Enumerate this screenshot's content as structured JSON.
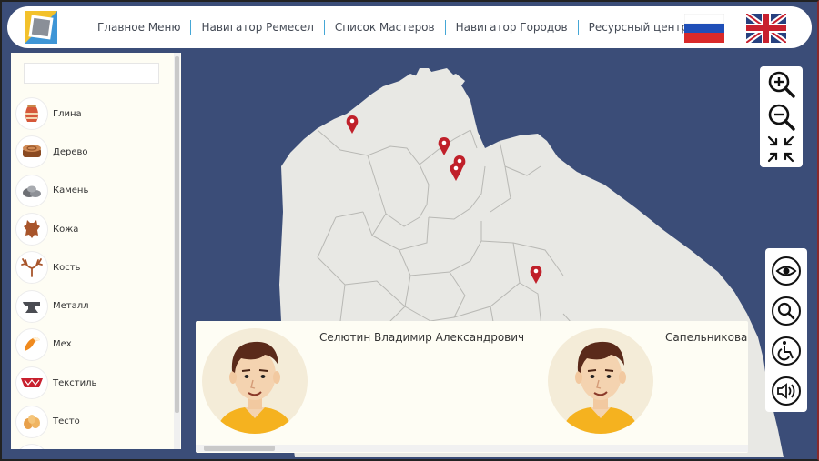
{
  "header": {
    "logo_icon": "app-logo-icon",
    "nav": [
      {
        "label": "Главное Меню"
      },
      {
        "label": "Навигатор Ремесел"
      },
      {
        "label": "Список Мастеров"
      },
      {
        "label": "Навигатор Городов"
      },
      {
        "label": "Ресурсный центр"
      }
    ],
    "lang_ru_icon": "russia-flag-icon",
    "lang_en_icon": "uk-flag-icon"
  },
  "sidebar": {
    "search": {
      "value": "",
      "placeholder": ""
    },
    "items": [
      {
        "label": "Глина",
        "icon": "clay-pot-icon"
      },
      {
        "label": "Дерево",
        "icon": "wood-log-icon"
      },
      {
        "label": "Камень",
        "icon": "stone-icon"
      },
      {
        "label": "Кожа",
        "icon": "leather-hide-icon"
      },
      {
        "label": "Кость",
        "icon": "antler-icon"
      },
      {
        "label": "Металл",
        "icon": "anvil-icon"
      },
      {
        "label": "Мех",
        "icon": "fur-icon"
      },
      {
        "label": "Текстиль",
        "icon": "textile-icon"
      },
      {
        "label": "Тесто",
        "icon": "dough-icon"
      }
    ]
  },
  "map": {
    "background": "#3b4d78",
    "land_color": "#e8e8e4",
    "marker_color": "#c0202a",
    "marker_count": 5
  },
  "controls": {
    "zoom": [
      "zoom-in-icon",
      "zoom-out-icon",
      "fit-map-icon"
    ],
    "accessibility": [
      "eye-icon",
      "magnifier-icon",
      "wheelchair-icon",
      "speaker-icon"
    ]
  },
  "masters": [
    {
      "name": "Селютин Владимир Александрович",
      "avatar": "user-avatar-icon"
    },
    {
      "name": "Сапельникова",
      "avatar": "user-avatar-icon"
    }
  ]
}
